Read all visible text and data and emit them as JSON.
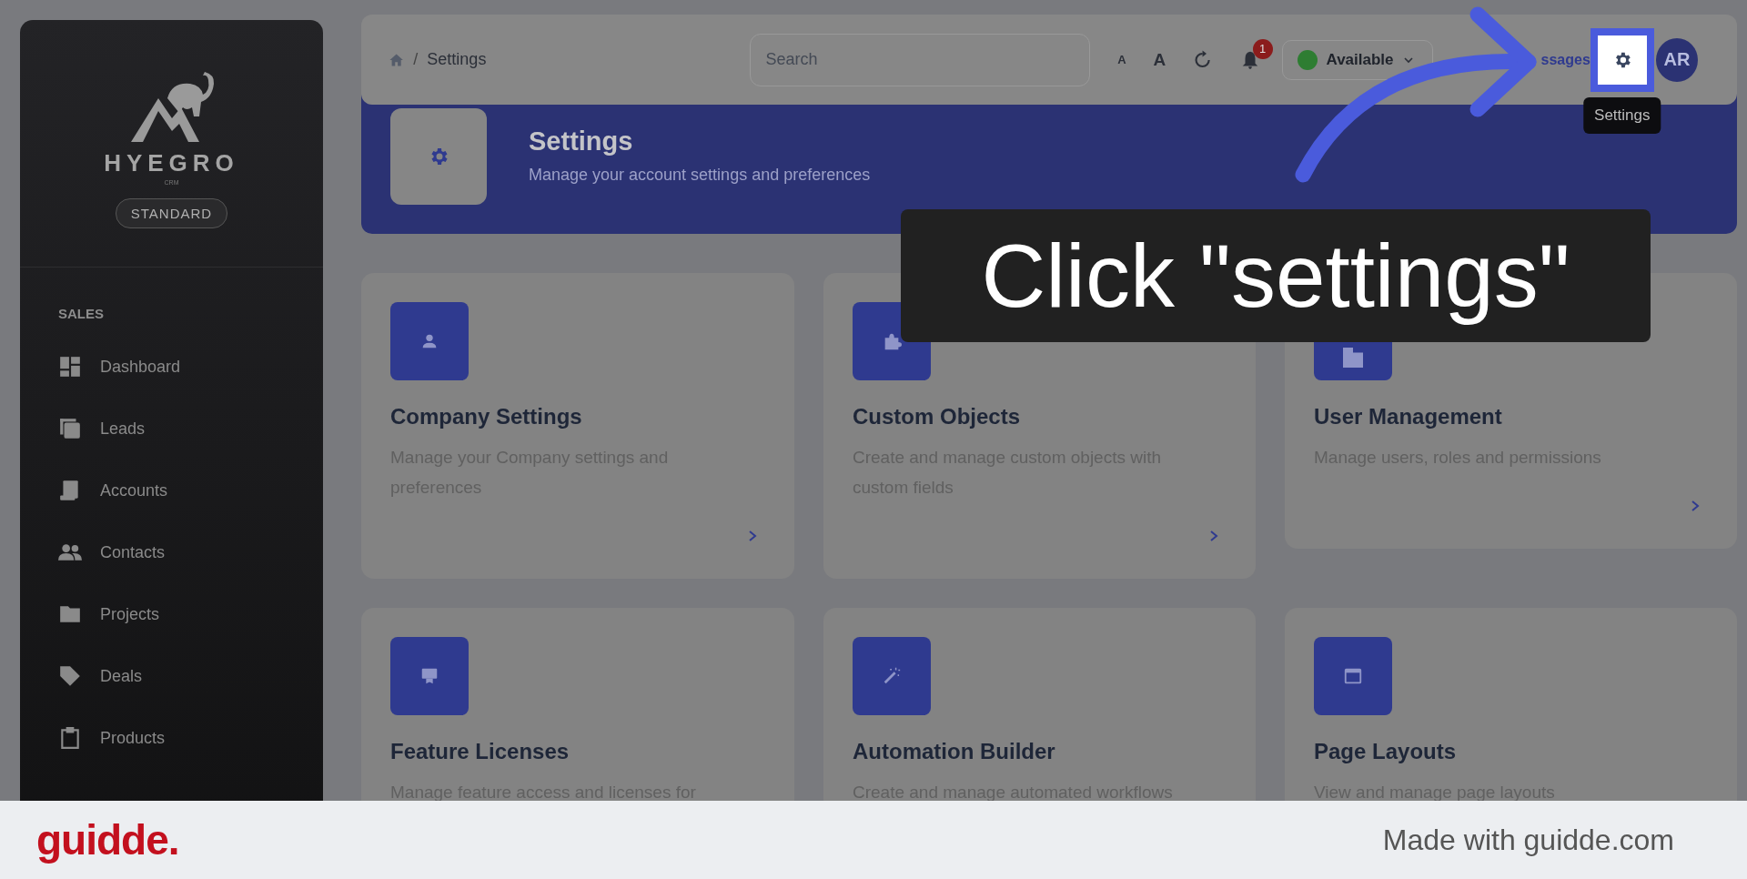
{
  "sidebar": {
    "brand": "HYEGRO",
    "brand_sub": "CRM",
    "plan": "STANDARD",
    "section": "SALES",
    "items": [
      {
        "label": "Dashboard"
      },
      {
        "label": "Leads"
      },
      {
        "label": "Accounts"
      },
      {
        "label": "Contacts"
      },
      {
        "label": "Projects"
      },
      {
        "label": "Deals"
      },
      {
        "label": "Products"
      }
    ]
  },
  "header": {
    "breadcrumb_separator": "/",
    "breadcrumb": "Settings",
    "search": {
      "placeholder": "Search"
    },
    "font_small": "A",
    "font_large": "A",
    "notifications": "1",
    "status": "Available",
    "messages_link": "ssages",
    "avatar": "AR",
    "tooltip": "Settings"
  },
  "banner": {
    "title": "Settings",
    "subtitle": "Manage your account settings and preferences"
  },
  "cards": [
    {
      "title": "Company Settings",
      "description": "Manage your Company settings and preferences"
    },
    {
      "title": "Custom Objects",
      "description": "Create and manage custom objects with custom fields"
    },
    {
      "title": "User Management",
      "description": "Manage users, roles and permissions"
    },
    {
      "title": "Feature Licenses",
      "description": "Manage feature access and licenses for"
    },
    {
      "title": "Automation Builder",
      "description": "Create and manage automated workflows"
    },
    {
      "title": "Page Layouts",
      "description": "View and manage page layouts"
    }
  ],
  "caption": "Click \"settings\"",
  "footer": {
    "logo": "guidde.",
    "credit": "Made with guidde.com"
  }
}
